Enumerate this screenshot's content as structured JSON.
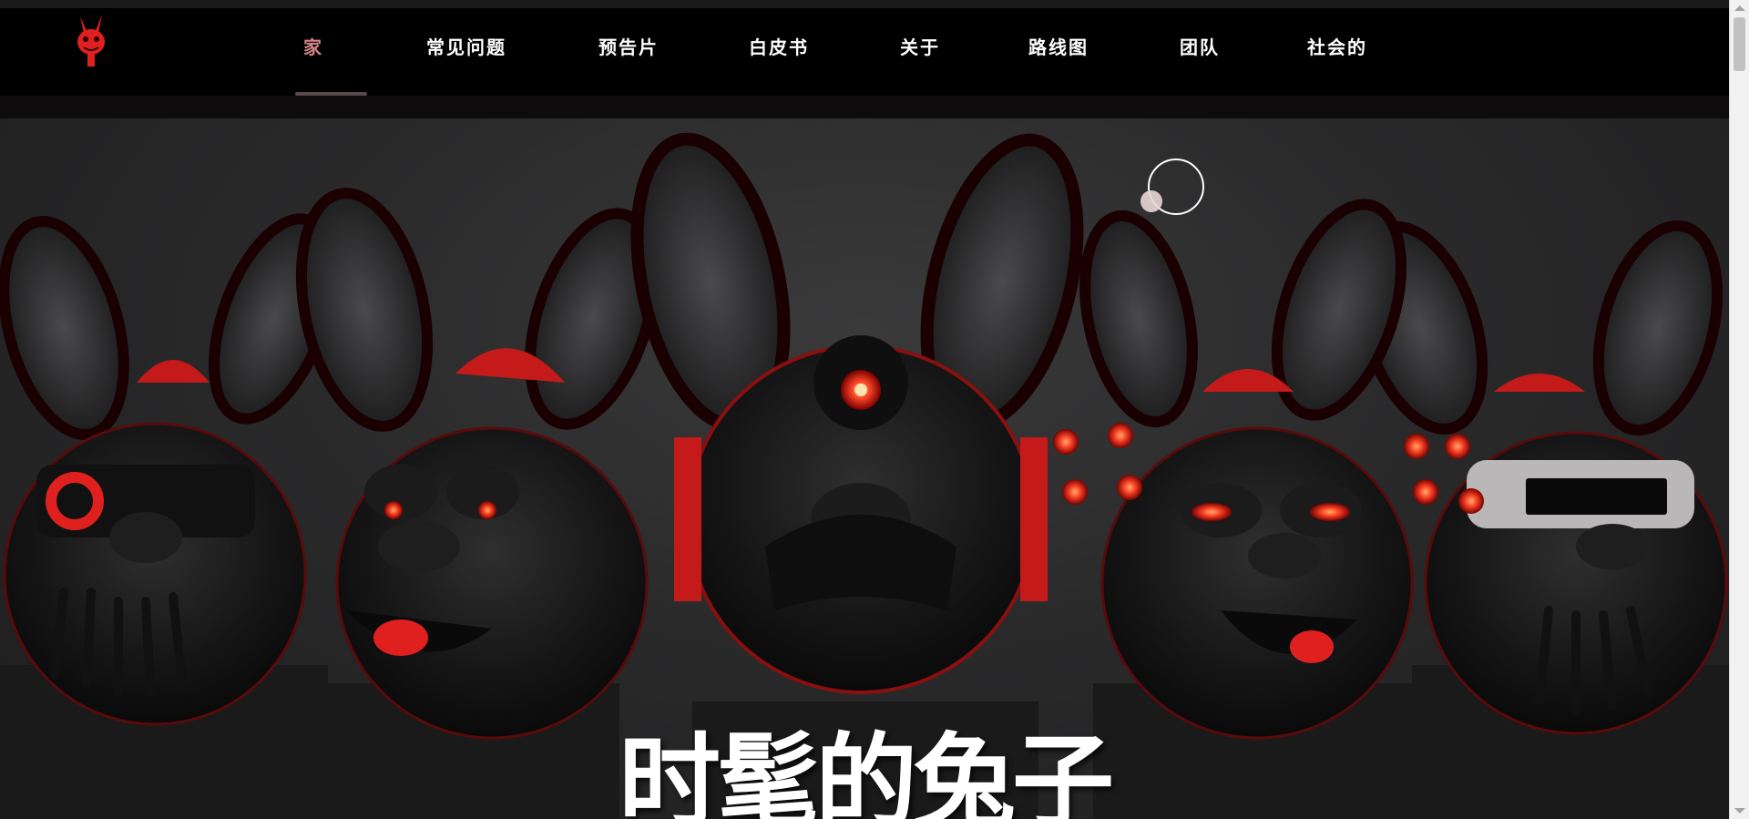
{
  "nav": {
    "items": [
      {
        "label": "家",
        "active": true
      },
      {
        "label": "常见问题"
      },
      {
        "label": "预告片"
      },
      {
        "label": "白皮书"
      },
      {
        "label": "关于"
      },
      {
        "label": "路线图"
      },
      {
        "label": "团队"
      },
      {
        "label": "社会的"
      }
    ]
  },
  "hero": {
    "title": "时髦的兔子"
  },
  "logo": {
    "icon": "rabbit-logo-icon"
  },
  "colors": {
    "accent_active": "#d4858a",
    "bg_nav": "#000000",
    "rabbit_red": "#e0201f",
    "eye_glow": "#ff4a2a"
  }
}
